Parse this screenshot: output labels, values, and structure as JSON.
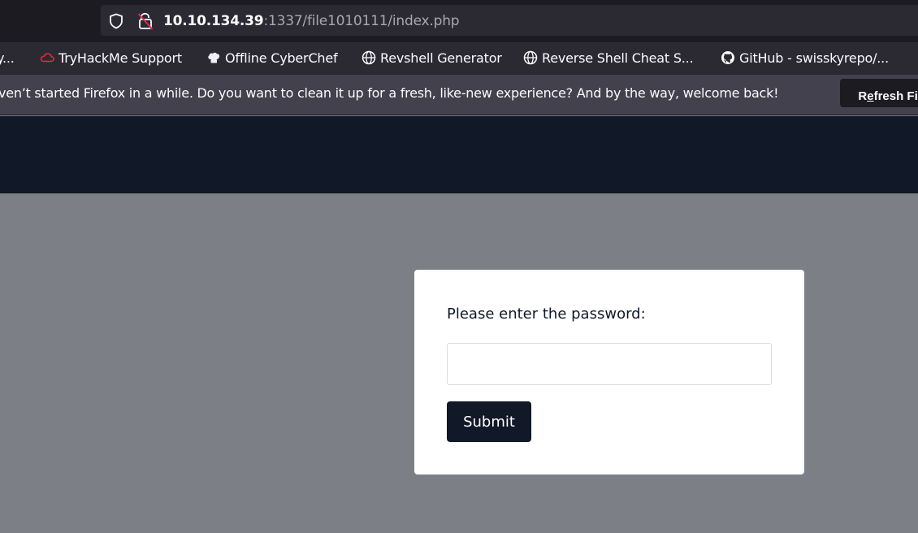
{
  "browser": {
    "url_host": "10.10.134.39",
    "url_rest": ":1337/file1010111/index.php",
    "icons": {
      "shield": "shield-icon",
      "lock": "insecure-lock-icon"
    }
  },
  "bookmarks": [
    {
      "label": "y...",
      "icon": ""
    },
    {
      "label": "TryHackMe Support",
      "icon": "tryhackme-cloud-icon"
    },
    {
      "label": "Offline CyberChef",
      "icon": "chef-hat-icon"
    },
    {
      "label": "Revshell Generator",
      "icon": "globe-icon"
    },
    {
      "label": "Reverse Shell Cheat S...",
      "icon": "globe-icon"
    },
    {
      "label": "GitHub - swisskyrepo/...",
      "icon": "github-icon"
    }
  ],
  "notification": {
    "message": "ven’t started Firefox in a while. Do you want to clean it up for a fresh, like-new experience? And by the way, welcome back!",
    "button_pre": "R",
    "button_underlined": "e",
    "button_post": "fresh Fir"
  },
  "form": {
    "label": "Please enter the password:",
    "password_value": "",
    "submit_label": "Submit"
  },
  "colors": {
    "header": "#111827",
    "page_bg": "#7c7f86",
    "button": "#111827"
  }
}
